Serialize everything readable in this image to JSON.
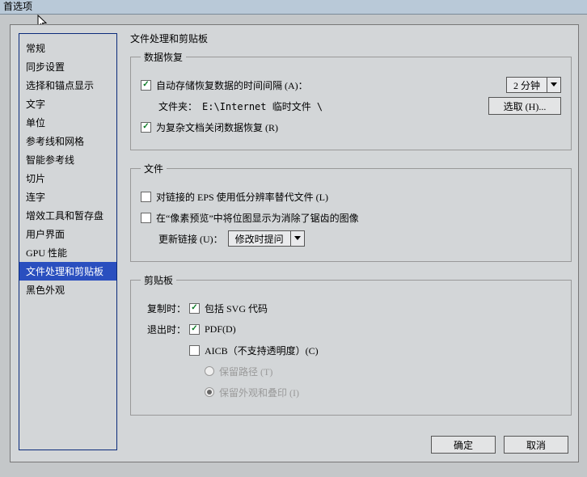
{
  "title": "首选项",
  "sidebar": {
    "items": [
      {
        "label": "常规"
      },
      {
        "label": "同步设置"
      },
      {
        "label": "选择和锚点显示"
      },
      {
        "label": "文字"
      },
      {
        "label": "单位"
      },
      {
        "label": "参考线和网格"
      },
      {
        "label": "智能参考线"
      },
      {
        "label": "切片"
      },
      {
        "label": "连字"
      },
      {
        "label": "增效工具和暂存盘"
      },
      {
        "label": "用户界面"
      },
      {
        "label": "GPU 性能"
      },
      {
        "label": "文件处理和剪贴板"
      },
      {
        "label": "黑色外观"
      }
    ],
    "selected": 12
  },
  "page_title": "文件处理和剪贴板",
  "recovery": {
    "legend": "数据恢复",
    "auto_save_label": "自动存储恢复数据的时间间隔 (A)：",
    "interval_value": "2 分钟",
    "folder_label": "文件夹：",
    "folder_value": "E:\\Internet 临时文件 \\",
    "choose_btn": "选取 (H)...",
    "complex_label": "为复杂文档关闭数据恢复 (R)"
  },
  "files": {
    "legend": "文件",
    "linked_eps_label": "对链接的 EPS 使用低分辨率替代文件 (L)",
    "pixel_preview_label": "在“像素预览”中将位图显示为消除了锯齿的图像",
    "update_links_label": "更新链接 (U)：",
    "update_links_value": "修改时提问"
  },
  "clipboard": {
    "legend": "剪贴板",
    "copy_label": "复制时：",
    "include_svg": "包括 SVG 代码",
    "quit_label": "退出时：",
    "pdf_label": "PDF(D)",
    "aicb_label": "AICB（不支持透明度）(C)",
    "keep_path_label": "保留路径 (T)",
    "keep_appearance_label": "保留外观和叠印 (I)"
  },
  "buttons": {
    "ok": "确定",
    "cancel": "取消"
  }
}
